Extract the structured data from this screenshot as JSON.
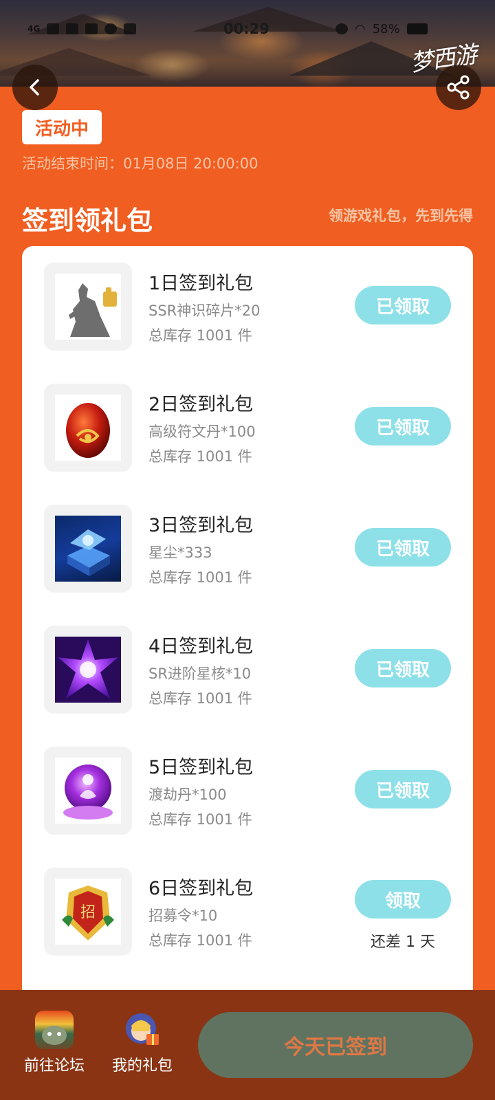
{
  "status_bar": {
    "network": "4G",
    "time": "00:29",
    "battery": "58%"
  },
  "header": {
    "logo_text": "梦西游"
  },
  "activity": {
    "badge": "活动中",
    "end_time": "活动结束时间：01月08日 20:00:00"
  },
  "section": {
    "title": "签到领礼包",
    "hint": "领游戏礼包，先到先得"
  },
  "gifts": [
    {
      "title": "1日签到礼包",
      "desc": "SSR神识碎片*20",
      "stock": "总库存 1001 件",
      "button": "已领取",
      "icon": "silhouette-fragment-icon"
    },
    {
      "title": "2日签到礼包",
      "desc": "高级符文丹*100",
      "stock": "总库存 1001 件",
      "button": "已领取",
      "icon": "rune-pill-icon"
    },
    {
      "title": "3日签到礼包",
      "desc": "星尘*333",
      "stock": "总库存 1001 件",
      "button": "已领取",
      "icon": "stardust-chest-icon"
    },
    {
      "title": "4日签到礼包",
      "desc": "SR进阶星核*10",
      "stock": "总库存 1001 件",
      "button": "已领取",
      "icon": "star-core-icon"
    },
    {
      "title": "5日签到礼包",
      "desc": "渡劫丹*100",
      "stock": "总库存 1001 件",
      "button": "已领取",
      "icon": "tribulation-pill-icon"
    },
    {
      "title": "6日签到礼包",
      "desc": "招募令*10",
      "stock": "总库存 1001 件",
      "button": "领取",
      "remain": "还差 1 天",
      "icon": "recruit-token-icon"
    }
  ],
  "bottom": {
    "forum_label": "前往论坛",
    "mygift_label": "我的礼包",
    "signed_label": "今天已签到"
  },
  "colors": {
    "background": "#F15E21",
    "claim_button": "#8EE0E8",
    "bottom_bar": "#8A3414",
    "signed_button": "#5F7360"
  }
}
